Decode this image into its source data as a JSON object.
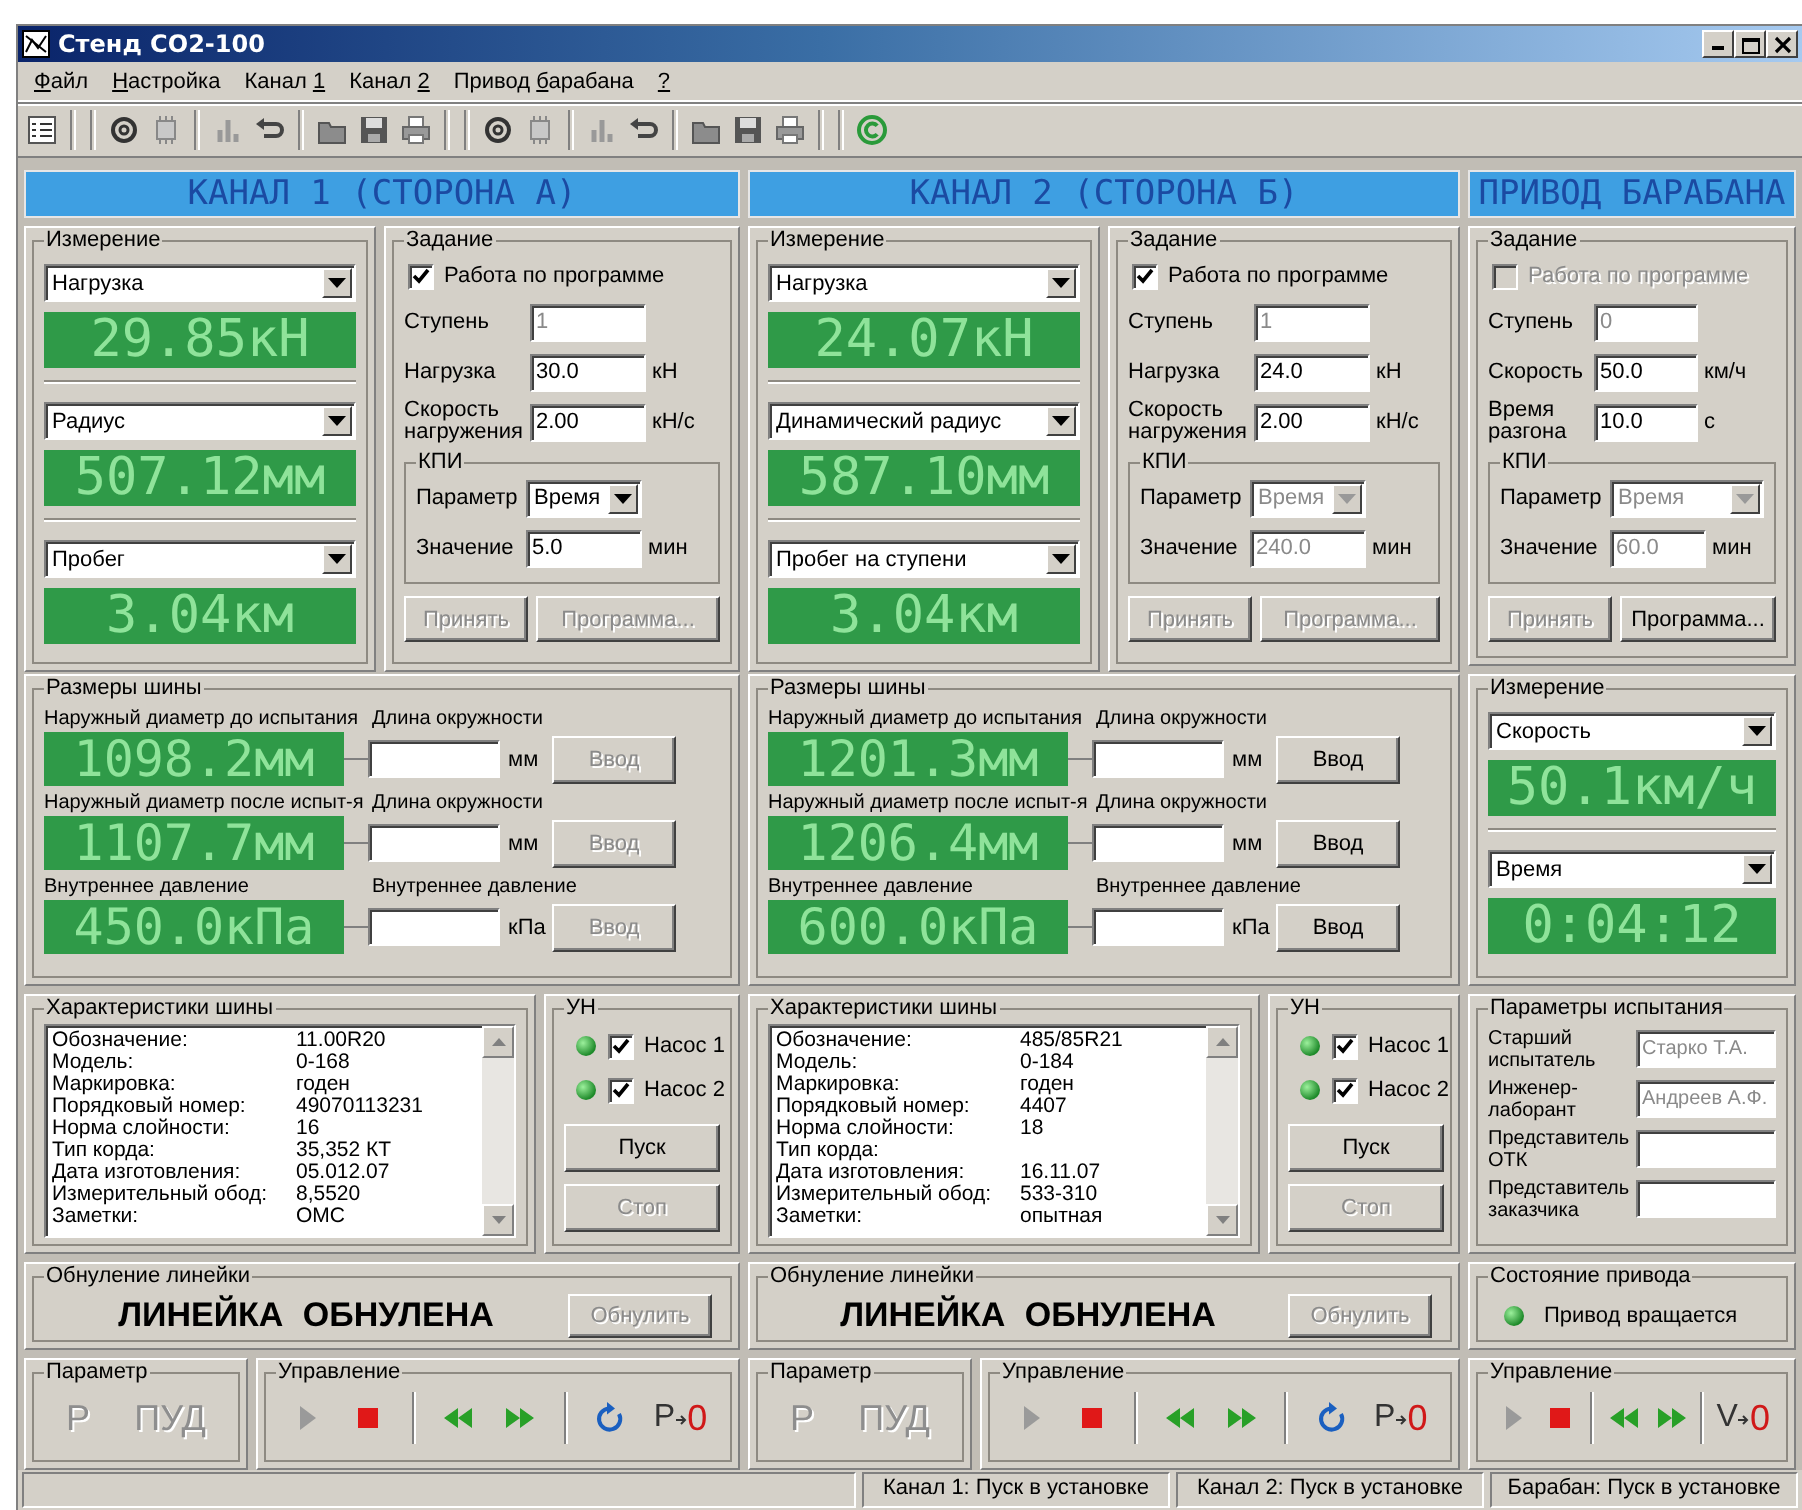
{
  "window": {
    "title": "Стенд СО2-100"
  },
  "menu": [
    {
      "key": "Ф",
      "post": "айл"
    },
    {
      "key": "Н",
      "post": "астройка"
    },
    {
      "pre": "Канал ",
      "key": "1"
    },
    {
      "pre": "Канал ",
      "key": "2"
    },
    {
      "pre": "Привод ",
      "key": "б",
      "post": "арабана"
    },
    {
      "key": "?"
    }
  ],
  "toolbar": [
    {
      "kind": "list"
    },
    {
      "kind": "separator"
    },
    {
      "kind": "separator"
    },
    {
      "kind": "ring"
    },
    {
      "kind": "chip"
    },
    {
      "kind": "separator"
    },
    {
      "kind": "chart"
    },
    {
      "kind": "undo"
    },
    {
      "kind": "separator"
    },
    {
      "kind": "folder"
    },
    {
      "kind": "save"
    },
    {
      "kind": "print"
    },
    {
      "kind": "separator"
    },
    {
      "kind": "separator"
    },
    {
      "kind": "ring"
    },
    {
      "kind": "chip"
    },
    {
      "kind": "separator"
    },
    {
      "kind": "chart"
    },
    {
      "kind": "undo"
    },
    {
      "kind": "separator"
    },
    {
      "kind": "folder"
    },
    {
      "kind": "save"
    },
    {
      "kind": "print"
    },
    {
      "kind": "separator"
    },
    {
      "kind": "separator"
    },
    {
      "kind": "copyright"
    }
  ],
  "channels": [
    {
      "header": "КАНАЛ 1 (СТОРОНА А)",
      "measurement": {
        "legend": "Измерение",
        "readouts": [
          {
            "select": "Нагрузка",
            "value": "29.85кН"
          },
          {
            "select": "Радиус",
            "value": "507.12мм"
          },
          {
            "select": "Пробег",
            "value": "3.04км"
          }
        ]
      },
      "task": {
        "legend": "Задание",
        "program": {
          "label": "Работа по программе",
          "checked": true,
          "disabled": false
        },
        "fields": [
          {
            "label": "Ступень",
            "value": "1",
            "disabled": true
          },
          {
            "label": "Нагрузка",
            "value": "30.0",
            "unit": "кН",
            "disabled": false
          },
          {
            "label": "Скорость нагружения",
            "value": "2.00",
            "unit": "кН/с",
            "disabled": false
          }
        ],
        "kpi": {
          "legend": "КПИ",
          "parameter": {
            "label": "Параметр",
            "value": "Время",
            "disabled": false
          },
          "amount": {
            "label": "Значение",
            "value": "5.0",
            "unit": "мин",
            "disabled": false
          }
        },
        "buttons": [
          {
            "label": "Принять",
            "disabled": true
          },
          {
            "label": "Программа...",
            "disabled": true
          }
        ]
      },
      "tire_sizes": {
        "legend": "Размеры шины",
        "rows": [
          {
            "label": "Наружный диаметр до испытания",
            "value": "1098.2мм",
            "input_label": "Длина окружности",
            "unit": "мм",
            "button": {
              "label": "Ввод",
              "disabled": true
            }
          },
          {
            "label": "Наружный диаметр после испыт-я",
            "value": "1107.7мм",
            "input_label": "Длина окружности",
            "unit": "мм",
            "button": {
              "label": "Ввод",
              "disabled": true
            }
          },
          {
            "label": "Внутреннее давление",
            "value": "450.0кПа",
            "input_label": "Внутреннее давление",
            "unit": "кПа",
            "button": {
              "label": "Ввод",
              "disabled": true
            }
          }
        ]
      },
      "characteristics": {
        "legend": "Характеристики шины",
        "rows": [
          {
            "label": "Обозначение:",
            "value": "11.00R20"
          },
          {
            "label": "Модель:",
            "value": "0-168"
          },
          {
            "label": "Маркировка:",
            "value": "годен"
          },
          {
            "label": "Порядковый номер:",
            "value": "49070113231"
          },
          {
            "label": "Норма слойности:",
            "value": "16"
          },
          {
            "label": "Тип корда:",
            "value": "35,352 КТ"
          },
          {
            "label": "Дата изготовления:",
            "value": "05.012.07"
          },
          {
            "label": "Измерительный обод:",
            "value": "8,5520"
          },
          {
            "label": "Заметки:",
            "value": "ОМС"
          }
        ]
      },
      "pumps": {
        "legend": "УН",
        "items": [
          {
            "label": "Насос 1",
            "checked": true,
            "on": true
          },
          {
            "label": "Насос 2",
            "checked": true,
            "on": true
          }
        ],
        "buttons": [
          {
            "label": "Пуск",
            "disabled": false
          },
          {
            "label": "Стоп",
            "disabled": true
          }
        ]
      },
      "zeroing": {
        "legend": "Обнуление линейки",
        "status": "ЛИНЕЙКА ОБНУЛЕНА",
        "button": {
          "label": "Обнулить",
          "disabled": true
        }
      },
      "parameter": {
        "legend": "Параметр",
        "buttons": [
          {
            "label": "Р",
            "disabled": true
          },
          {
            "label": "ПУД",
            "disabled": true
          }
        ]
      },
      "control": {
        "legend": "Управление",
        "buttons": [
          {
            "kind": "play",
            "disabled": true
          },
          {
            "kind": "stop",
            "disabled": false
          },
          {
            "kind": "separator"
          },
          {
            "kind": "rewind",
            "disabled": false
          },
          {
            "kind": "forward",
            "disabled": false
          },
          {
            "kind": "separator"
          },
          {
            "kind": "refresh",
            "disabled": false
          },
          {
            "kind": "zero",
            "from": "Р",
            "to": "0",
            "disabled": false
          }
        ]
      }
    },
    {
      "header": "КАНАЛ 2 (СТОРОНА Б)",
      "measurement": {
        "legend": "Измерение",
        "readouts": [
          {
            "select": "Нагрузка",
            "value": "24.07кН"
          },
          {
            "select": "Динамический радиус",
            "value": "587.10мм"
          },
          {
            "select": "Пробег на ступени",
            "value": "3.04км"
          }
        ]
      },
      "task": {
        "legend": "Задание",
        "program": {
          "label": "Работа по программе",
          "checked": true,
          "disabled": false
        },
        "fields": [
          {
            "label": "Ступень",
            "value": "1",
            "disabled": true
          },
          {
            "label": "Нагрузка",
            "value": "24.0",
            "unit": "кН",
            "disabled": false
          },
          {
            "label": "Скорость нагружения",
            "value": "2.00",
            "unit": "кН/с",
            "disabled": false
          }
        ],
        "kpi": {
          "legend": "КПИ",
          "parameter": {
            "label": "Параметр",
            "value": "Время",
            "disabled": true
          },
          "amount": {
            "label": "Значение",
            "value": "240.0",
            "unit": "мин",
            "disabled": true
          }
        },
        "buttons": [
          {
            "label": "Принять",
            "disabled": true
          },
          {
            "label": "Программа...",
            "disabled": true
          }
        ]
      },
      "tire_sizes": {
        "legend": "Размеры шины",
        "rows": [
          {
            "label": "Наружный диаметр до испытания",
            "value": "1201.3мм",
            "input_label": "Длина окружности",
            "unit": "мм",
            "button": {
              "label": "Ввод",
              "disabled": false
            }
          },
          {
            "label": "Наружный диаметр после испыт-я",
            "value": "1206.4мм",
            "input_label": "Длина окружности",
            "unit": "мм",
            "button": {
              "label": "Ввод",
              "disabled": false
            }
          },
          {
            "label": "Внутреннее давление",
            "value": "600.0кПа",
            "input_label": "Внутреннее давление",
            "unit": "кПа",
            "button": {
              "label": "Ввод",
              "disabled": false
            }
          }
        ]
      },
      "characteristics": {
        "legend": "Характеристики шины",
        "rows": [
          {
            "label": "Обозначение:",
            "value": "485/85R21"
          },
          {
            "label": "Модель:",
            "value": "0-184"
          },
          {
            "label": "Маркировка:",
            "value": "годен"
          },
          {
            "label": "Порядковый номер:",
            "value": "4407"
          },
          {
            "label": "Норма слойности:",
            "value": "18"
          },
          {
            "label": "Тип корда:"
          },
          {
            "label": "Дата изготовления:",
            "value": "16.11.07"
          },
          {
            "label": "Измерительный обод:",
            "value": "533-310"
          },
          {
            "label": "Заметки:",
            "value": "опытная"
          }
        ]
      },
      "pumps": {
        "legend": "УН",
        "items": [
          {
            "label": "Насос 1",
            "checked": true,
            "on": true
          },
          {
            "label": "Насос 2",
            "checked": true,
            "on": true
          }
        ],
        "buttons": [
          {
            "label": "Пуск",
            "disabled": false
          },
          {
            "label": "Стоп",
            "disabled": true
          }
        ]
      },
      "zeroing": {
        "legend": "Обнуление линейки",
        "status": "ЛИНЕЙКА ОБНУЛЕНА",
        "button": {
          "label": "Обнулить",
          "disabled": true
        }
      },
      "parameter": {
        "legend": "Параметр",
        "buttons": [
          {
            "label": "Р",
            "disabled": true
          },
          {
            "label": "ПУД",
            "disabled": true
          }
        ]
      },
      "control": {
        "legend": "Управление",
        "buttons": [
          {
            "kind": "play",
            "disabled": true
          },
          {
            "kind": "stop",
            "disabled": false
          },
          {
            "kind": "separator"
          },
          {
            "kind": "rewind",
            "disabled": false
          },
          {
            "kind": "forward",
            "disabled": false
          },
          {
            "kind": "separator"
          },
          {
            "kind": "refresh",
            "disabled": false
          },
          {
            "kind": "zero",
            "from": "Р",
            "to": "0",
            "disabled": false
          }
        ]
      }
    }
  ],
  "drum": {
    "header": "ПРИВОД БАРАБАНА",
    "task": {
      "legend": "Задание",
      "program": {
        "label": "Работа по программе",
        "checked": false,
        "disabled": true
      },
      "fields": [
        {
          "label": "Ступень",
          "value": "0",
          "disabled": true
        },
        {
          "label": "Скорость",
          "value": "50.0",
          "unit": "км/ч",
          "disabled": false
        },
        {
          "label": "Время разгона",
          "value": "10.0",
          "unit": "с",
          "disabled": false
        }
      ],
      "kpi": {
        "legend": "КПИ",
        "parameter": {
          "label": "Параметр",
          "value": "Время",
          "disabled": true
        },
        "amount": {
          "label": "Значение",
          "value": "60.0",
          "unit": "мин",
          "disabled": true
        }
      },
      "buttons": [
        {
          "label": "Принять",
          "disabled": true
        },
        {
          "label": "Программа...",
          "disabled": false
        }
      ]
    },
    "measurement": {
      "legend": "Измерение",
      "readouts": [
        {
          "select": "Скорость",
          "value": "50.1км/ч"
        },
        {
          "select": "Время",
          "value": "0:04:12"
        }
      ]
    },
    "test_params": {
      "legend": "Параметры испытания",
      "fields": [
        {
          "label": "Старший испытатель",
          "value": "Старко Т.А.",
          "disabled": true
        },
        {
          "label": "Инженер-лаборант",
          "value": "Андреев А.Ф.",
          "disabled": true
        },
        {
          "label": "Представитель ОТК"
        },
        {
          "label": "Представитель заказчика"
        }
      ]
    },
    "drive_state": {
      "legend": "Состояние привода",
      "status": "Привод вращается",
      "on": true
    },
    "control": {
      "legend": "Управление",
      "buttons": [
        {
          "kind": "play",
          "disabled": true
        },
        {
          "kind": "stop",
          "disabled": false
        },
        {
          "kind": "separator"
        },
        {
          "kind": "rewind",
          "disabled": false
        },
        {
          "kind": "forward",
          "disabled": false
        },
        {
          "kind": "separator"
        },
        {
          "kind": "zero",
          "from": "V",
          "to": "0",
          "disabled": false
        }
      ]
    }
  },
  "status_bar": [
    "Канал 1: Пуск в установке",
    "Канал 2: Пуск в установке",
    "Барабан: Пуск в установке"
  ]
}
